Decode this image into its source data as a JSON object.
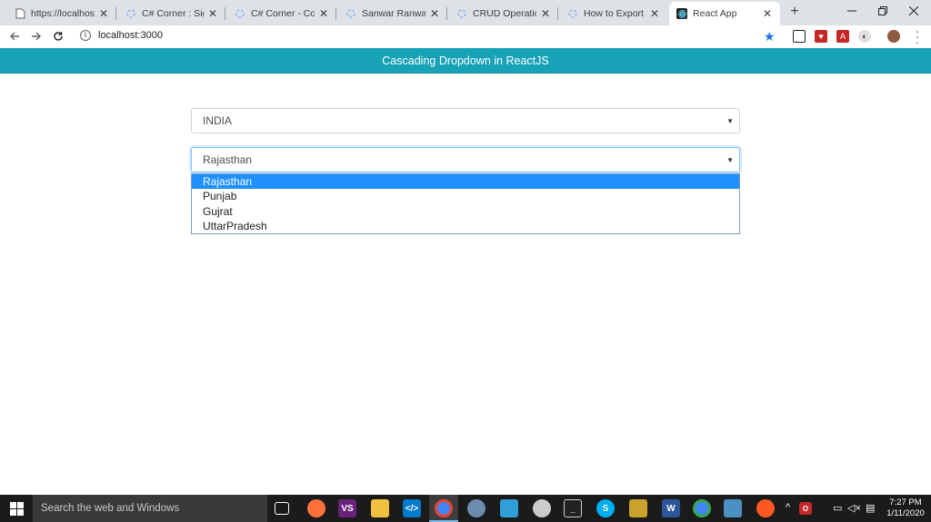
{
  "browser": {
    "tabs": [
      {
        "title": "https://localhost:4",
        "favicon": "page-icon"
      },
      {
        "title": "C# Corner : Sign in",
        "favicon": "csharpcorner-icon"
      },
      {
        "title": "C# Corner - Comm",
        "favicon": "csharpcorner-icon"
      },
      {
        "title": "Sanwar Ranwa's A",
        "favicon": "csharpcorner-icon"
      },
      {
        "title": "CRUD Operations",
        "favicon": "csharpcorner-icon"
      },
      {
        "title": "How to Export Dat",
        "favicon": "csharpcorner-icon"
      },
      {
        "title": "React App",
        "favicon": "react-icon",
        "active": true
      }
    ],
    "new_tab": "+",
    "url": "localhost:3000"
  },
  "app": {
    "header_title": "Cascading Dropdown in ReactJS",
    "country_select": {
      "value": "INDIA"
    },
    "state_select": {
      "value": "Rajasthan",
      "options": [
        "Rajasthan",
        "Punjab",
        "Gujrat",
        "UttarPradesh"
      ],
      "highlighted": "Rajasthan"
    }
  },
  "taskbar": {
    "search_placeholder": "Search the web and Windows",
    "time": "7:27 PM",
    "date": "1/11/2020"
  },
  "colors": {
    "header_bg": "#17a2b8",
    "highlight": "#1e90ff",
    "tab_strip": "#dee1e6",
    "taskbar": "#1b1b1b"
  }
}
